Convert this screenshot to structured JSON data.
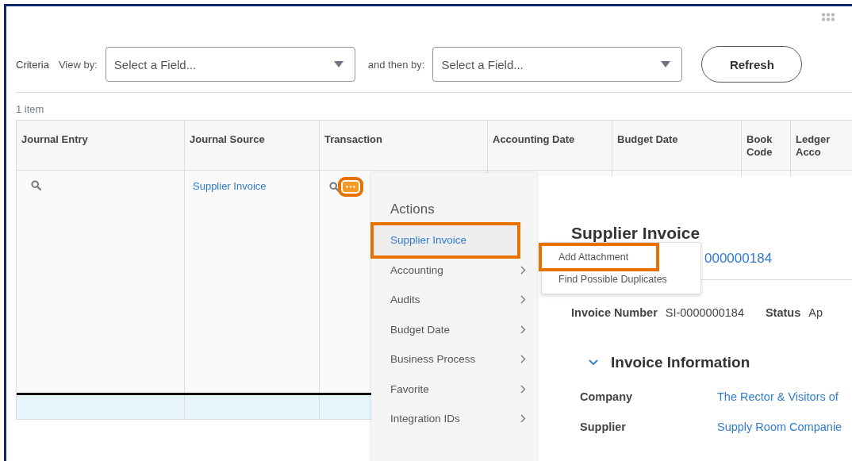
{
  "criteria": {
    "label": "Criteria",
    "view_by": {
      "label": "View by:",
      "placeholder": "Select a Field..."
    },
    "then_by": {
      "label": "and then by:",
      "placeholder": "Select a Field..."
    },
    "refresh": "Refresh"
  },
  "item_count": "1 item",
  "table": {
    "columns": [
      "Journal Entry",
      "Journal Source",
      "Transaction",
      "Accounting Date",
      "Budget Date",
      "Book Code",
      "Ledger Acco"
    ],
    "rows": [
      {
        "journal_source": "Supplier Invoice",
        "related_actions": {
          "highlighted": true
        }
      }
    ]
  },
  "actions_menu": {
    "title": "Actions",
    "items": [
      {
        "label": "Supplier Invoice",
        "selected": true,
        "highlighted": true
      },
      {
        "label": "Accounting",
        "selected": false,
        "highlighted": false
      },
      {
        "label": "Audits",
        "selected": false,
        "highlighted": false
      },
      {
        "label": "Budget Date",
        "selected": false,
        "highlighted": false
      },
      {
        "label": "Business Process",
        "selected": false,
        "highlighted": false
      },
      {
        "label": "Favorite",
        "selected": false,
        "highlighted": false
      },
      {
        "label": "Integration IDs",
        "selected": false,
        "highlighted": false
      }
    ]
  },
  "submenu": {
    "items": [
      {
        "label": "Add Attachment",
        "highlighted": true
      },
      {
        "label": "Find Possible Duplicates",
        "highlighted": false
      }
    ]
  },
  "preview": {
    "title": "Supplier Invoice",
    "link": "000000184",
    "fields": [
      {
        "label": "Invoice Number",
        "value": "SI-0000000184"
      },
      {
        "label": "Status",
        "value": "Ap"
      }
    ],
    "section": {
      "title": "Invoice Information",
      "expanded": true,
      "fields": [
        {
          "label": "Company",
          "value": "The Rector & Visitors of"
        },
        {
          "label": "Supplier",
          "value": "Supply Room Companie"
        }
      ]
    }
  }
}
